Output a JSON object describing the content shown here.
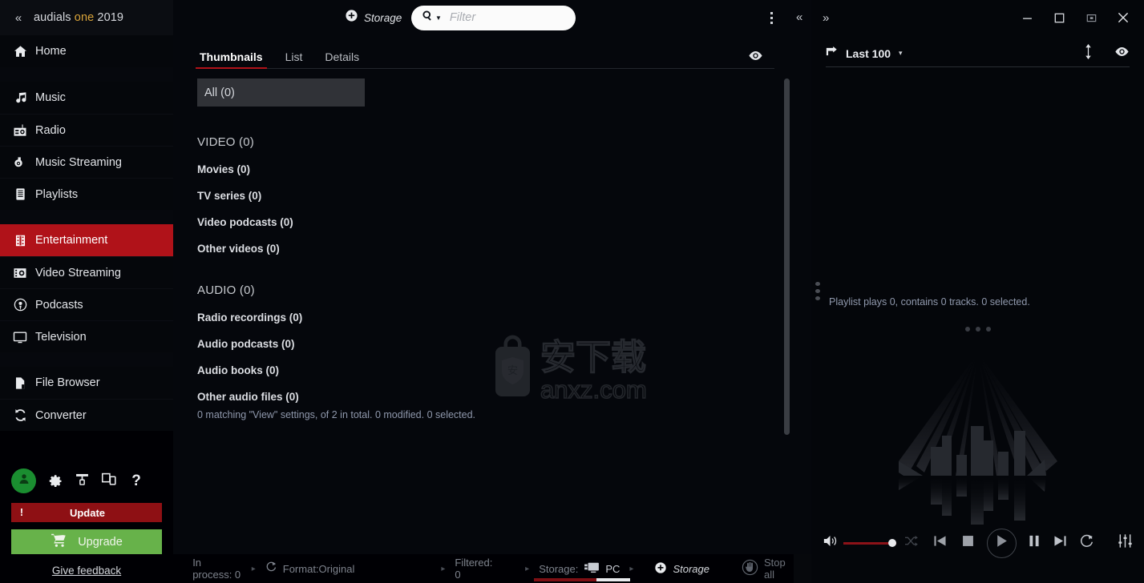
{
  "brand": {
    "part1": "audials ",
    "part2": "one",
    "part3": " 2019",
    "collapse_icon": "«"
  },
  "sidebar": {
    "items": [
      {
        "label": "Home",
        "icon": "home-icon",
        "active": false
      },
      {
        "label": "Music",
        "icon": "music-note-icon",
        "active": false
      },
      {
        "label": "Radio",
        "icon": "radio-icon",
        "active": false
      },
      {
        "label": "Music Streaming",
        "icon": "music-streaming-icon",
        "active": false
      },
      {
        "label": "Playlists",
        "icon": "playlists-icon",
        "active": false
      },
      {
        "label": "Entertainment",
        "icon": "film-strip-icon",
        "active": true
      },
      {
        "label": "Video Streaming",
        "icon": "video-streaming-icon",
        "active": false
      },
      {
        "label": "Podcasts",
        "icon": "podcast-icon",
        "active": false
      },
      {
        "label": "Television",
        "icon": "television-icon",
        "active": false
      },
      {
        "label": "File Browser",
        "icon": "file-browser-icon",
        "active": false
      },
      {
        "label": "Converter",
        "icon": "converter-icon",
        "active": false
      }
    ],
    "bottom": {
      "account_icon": "person-icon",
      "settings_icon": "gear-icon",
      "theme_icon": "paint-roller-icon",
      "devices_icon": "devices-icon",
      "help_icon": "?",
      "update_label": "Update",
      "update_badge": "!",
      "upgrade_label": "Upgrade",
      "upgrade_icon": "shopping-cart-icon",
      "feedback_label": "Give feedback"
    },
    "accent_active": "#b01219",
    "accent_update": "#8e1014",
    "accent_upgrade": "#67b24a"
  },
  "main": {
    "toolbar": {
      "storage_label": "Storage",
      "storage_icon": "plus-circle-icon",
      "filter_placeholder": "Filter",
      "filter_value": "",
      "search_icon": "magnifier-icon",
      "menu_icon": "kebab-menu-icon"
    },
    "tabs": [
      {
        "label": "Thumbnails",
        "active": true
      },
      {
        "label": "List",
        "active": false
      },
      {
        "label": "Details",
        "active": false
      }
    ],
    "eye_icon": "eye-icon",
    "all_chip": "All (0)",
    "groups": [
      {
        "header": "VIDEO (0)",
        "items": [
          "Movies (0)",
          "TV series (0)",
          "Video podcasts (0)",
          "Other videos (0)"
        ]
      },
      {
        "header": "AUDIO (0)",
        "items": [
          "Radio recordings (0)",
          "Audio podcasts (0)",
          "Audio books (0)",
          "Other audio files (0)"
        ]
      }
    ],
    "footnote": "0 matching \"View\" settings, of 2 in total. 0 modified. 0 selected.",
    "watermark": {
      "text_cn": "安下载",
      "text_en": "anxz.com"
    }
  },
  "right": {
    "collapse_left_icon": "«",
    "collapse_right_icon": "»",
    "window": {
      "minimize": "–",
      "maximize": "□",
      "restore_mini": "▣",
      "close": "✕"
    },
    "playlist": {
      "selector_label": "Last 100",
      "selector_icon": "arrow-into-icon",
      "caret": "▾",
      "sort_icon": "sort-updown-icon",
      "eye_icon": "eye-icon",
      "status": "Playlist plays 0, contains 0 tracks. 0 selected."
    },
    "player": {
      "volume_icon": "speaker-icon",
      "volume_value": 85,
      "shuffle_icon": "shuffle-icon",
      "previous_icon": "previous-track-icon",
      "stop_icon": "stop-icon",
      "play_icon": "play-icon",
      "pause_icon": "pause-icon",
      "next_icon": "next-track-icon",
      "repeat_icon": "repeat-icon",
      "equalizer_icon": "equalizer-icon"
    }
  },
  "statusbar": {
    "in_process": "In process: 0",
    "format": "Format:Original",
    "format_icon": "refresh-icon",
    "filtered": "Filtered: 0",
    "storage_label": "Storage:",
    "storage_device": "PC",
    "storage_device_icon": "pc-icon",
    "add_storage_label": "Storage",
    "add_storage_icon": "plus-circle-icon",
    "stop_all_label": "Stop all",
    "stop_all_icon": "hand-stop-icon",
    "arrow": "▸"
  }
}
